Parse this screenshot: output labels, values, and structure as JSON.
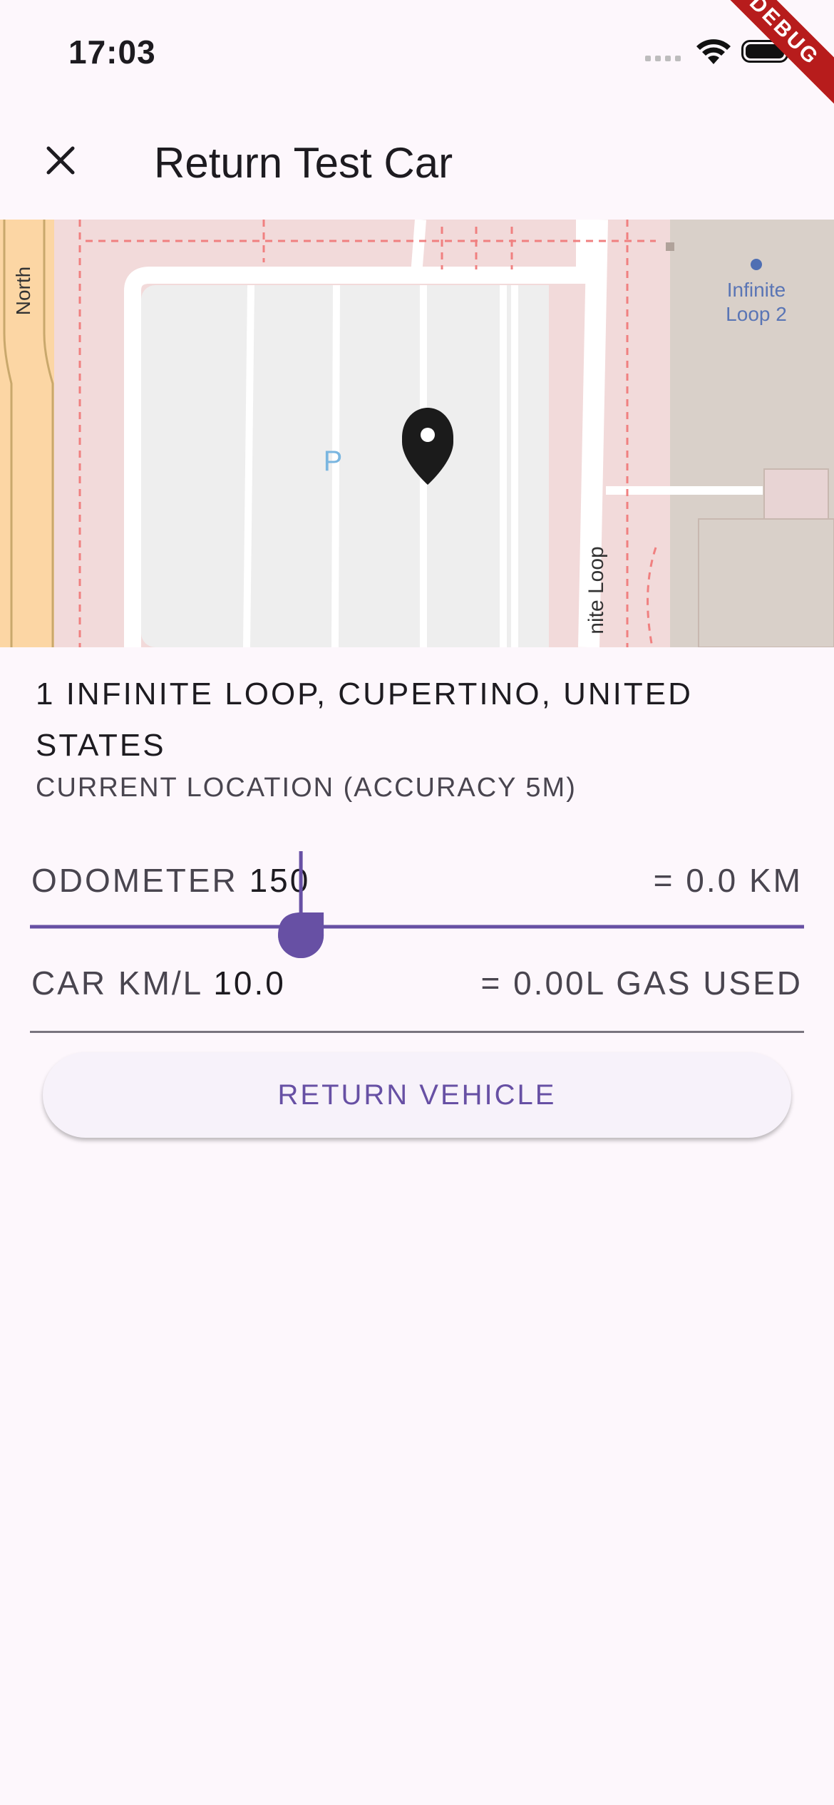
{
  "status_bar": {
    "time": "17:03"
  },
  "debug_banner": "DEBUG",
  "app_bar": {
    "title": "Return Test Car",
    "close_icon": "close-icon"
  },
  "map": {
    "labels": {
      "road_north": "North",
      "building": "Infinite\nLoop 2",
      "building_line1": "Infinite",
      "building_line2": "Loop 2",
      "parking": "P",
      "road_loop": "nite Loop"
    },
    "pin_icon": "location-pin-icon"
  },
  "location": {
    "address": "1 INFINITE LOOP, CUPERTINO, UNITED STATES",
    "accuracy": "CURRENT LOCATION (ACCURACY 5M)"
  },
  "odometer": {
    "label": "ODOMETER ",
    "value": "150",
    "distance": "= 0.0 KM",
    "slider_fraction": 0.35
  },
  "car_kml": {
    "label": "CAR KM/L ",
    "value": "10.0",
    "gas": "= 0.00L GAS USED"
  },
  "actions": {
    "return_label": "RETURN VEHICLE"
  },
  "colors": {
    "accent": "#6750a4",
    "background": "#fdf7fc"
  }
}
